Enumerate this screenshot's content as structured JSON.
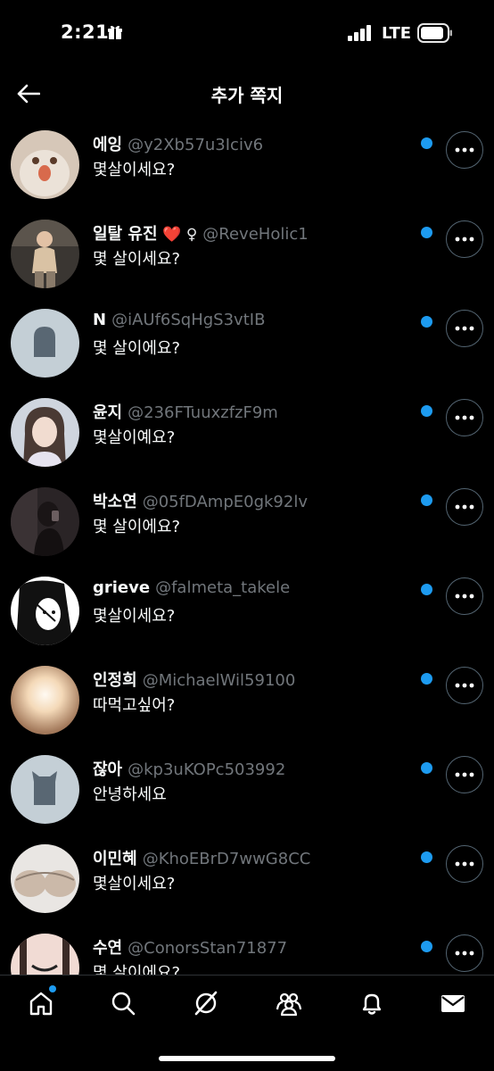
{
  "status_bar": {
    "time": "2:21",
    "network": "LTE"
  },
  "header": {
    "title": "추가 쪽지",
    "back_icon": "arrow-left-icon"
  },
  "messages": [
    {
      "name": "에잉",
      "emoji": "",
      "handle": "@y2Xb57u3Iciv6",
      "preview": "몇살이세요?",
      "unread": true
    },
    {
      "name": "일탈 유진",
      "emoji": "❤️ ♀",
      "handle": "@ReveHolic1",
      "preview": "몇 살이세요?",
      "unread": true
    },
    {
      "name": "N",
      "emoji": "",
      "handle": "@iAUf6SqHgS3vtIB",
      "preview": "몇 살이에요?",
      "unread": true
    },
    {
      "name": "윤지",
      "emoji": "",
      "handle": "@236FTuuxzfzF9m",
      "preview": "몇살이예요?",
      "unread": true
    },
    {
      "name": "박소연",
      "emoji": "",
      "handle": "@05fDAmpE0gk92lv",
      "preview": "몇 살이에요?",
      "unread": true
    },
    {
      "name": "grieve",
      "emoji": "",
      "handle": "@falmeta_takele",
      "preview": "몇살이세요?",
      "unread": true
    },
    {
      "name": "인정희",
      "emoji": "",
      "handle": "@MichaelWil59100",
      "preview": "따먹고싶어?",
      "unread": true
    },
    {
      "name": "잖아",
      "emoji": "",
      "handle": "@kp3uKOPc503992",
      "preview": "안녕하세요",
      "unread": true
    },
    {
      "name": "이민혜",
      "emoji": "",
      "handle": "@KhoEBrD7wwG8CC",
      "preview": "몇살이세요?",
      "unread": true
    },
    {
      "name": "수연",
      "emoji": "",
      "handle": "@ConorsStan71877",
      "preview": "몇 살이에요?",
      "unread": true
    }
  ],
  "tab_bar": {
    "tabs": [
      "home-icon",
      "search-icon",
      "grok-icon",
      "communities-icon",
      "notifications-icon",
      "messages-icon"
    ],
    "home_has_badge": true
  },
  "colors": {
    "accent": "#1d9bf0",
    "background": "#000000",
    "secondary_text": "#71767b"
  }
}
